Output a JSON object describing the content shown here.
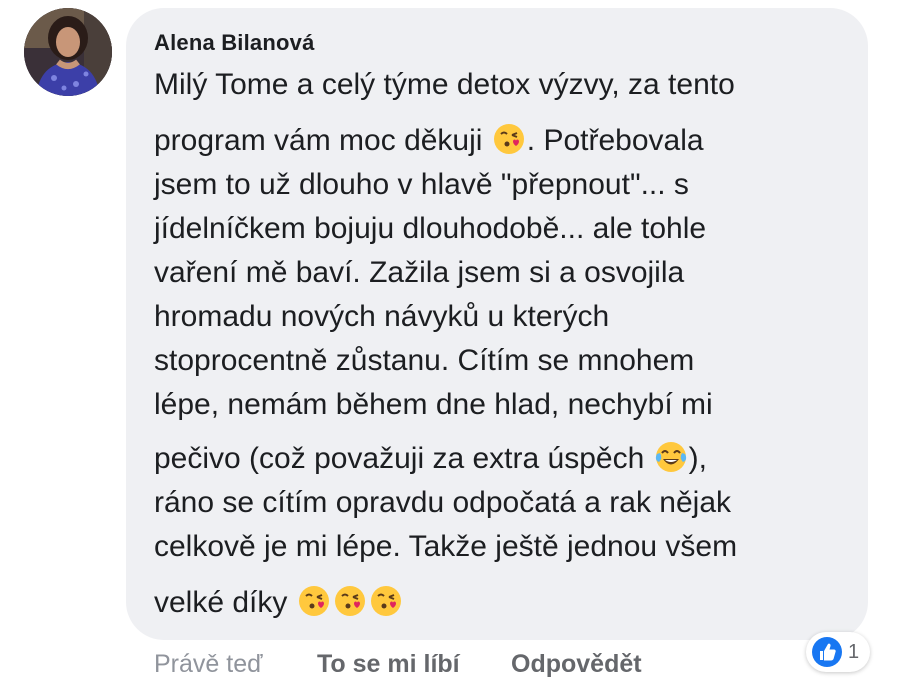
{
  "comment": {
    "author": "Alena Bilanová",
    "lines": [
      {
        "text": "Milý Tome a celý týme detox výzvy, za tento"
      },
      {
        "before": "program vám moc děkuji ",
        "emoji": "face-blowing-kiss-emoji",
        "after": ". Potřebovala"
      },
      {
        "text": "jsem to už dlouho v hlavě \"přepnout\"... s"
      },
      {
        "text": "jídelníčkem bojuju dlouhodobě... ale tohle"
      },
      {
        "text": "vaření mě baví. Zažila jsem si a osvojila"
      },
      {
        "text": "hromadu nových návyků u kterých"
      },
      {
        "text": "stoprocentně zůstanu. Cítím se mnohem"
      },
      {
        "text": "lépe, nemám během dne hlad, nechybí mi"
      },
      {
        "before": "pečivo (což považuji za extra úspěch ",
        "emoji": "face-with-tears-of-joy-emoji",
        "after": "),"
      },
      {
        "text": "ráno se cítím opravdu odpočatá a rak nějak"
      },
      {
        "text": "celkově je mi lépe. Takže ještě jednou všem"
      },
      {
        "before": "velké díky ",
        "emojis": [
          "face-blowing-kiss-emoji",
          "face-blowing-kiss-emoji",
          "face-blowing-kiss-emoji"
        ]
      }
    ]
  },
  "actions": {
    "timestamp": "Právě teď",
    "like_label": "To se mi líbí",
    "reply_label": "Odpovědět"
  },
  "reactions": {
    "icon": "thumbs-up-icon",
    "count": "1",
    "color": "#1877f2"
  },
  "colors": {
    "bubble": "#eff0f3",
    "text": "#1c1e21",
    "muted": "#90949c",
    "action": "#65676b"
  }
}
